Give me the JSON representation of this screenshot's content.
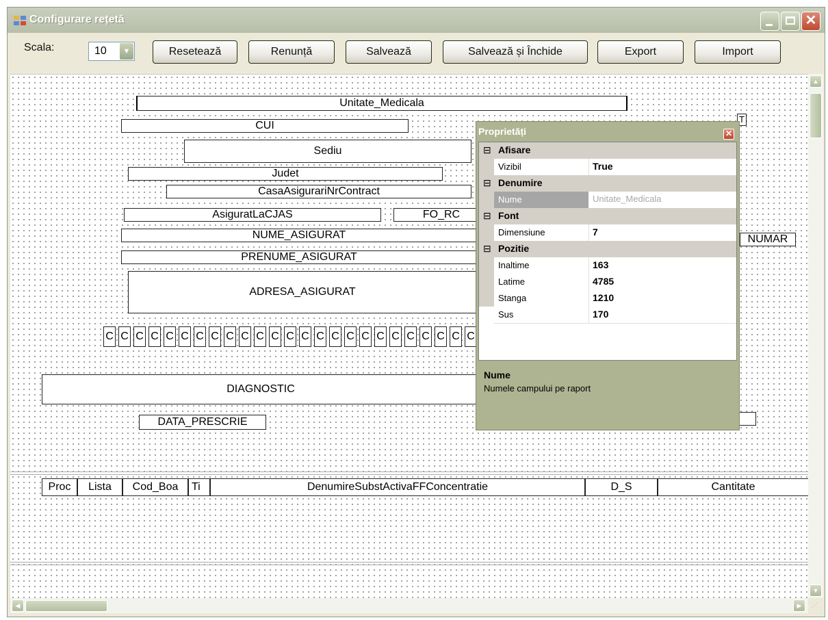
{
  "window": {
    "title": "Configurare rețetă"
  },
  "toolbar": {
    "scale_label": "Scala:",
    "scale_value": "10",
    "buttons": [
      "Resetează",
      "Renunță",
      "Salvează",
      "Salvează și Închide",
      "Export",
      "Import"
    ]
  },
  "canvas": {
    "fields": [
      "Unitate_Medicala",
      "CUI",
      "Sediu",
      "Judet",
      "CasaAsigurariNrContract",
      "AsiguratLaCJAS",
      "FO_RC",
      "NUME_ASIGURAT",
      "NUMAR",
      "PRENUME_ASIGURAT",
      "ADRESA_ASIGURAT",
      "DIAGNOSTIC",
      "DATA_PRESCRIE",
      "T"
    ],
    "char_box_label": "C",
    "table_headers": [
      "Proc",
      "Lista",
      "Cod_Boa",
      "Ti",
      "DenumireSubstActivaFFConcentratie",
      "D_S",
      "Cantitate"
    ]
  },
  "properties_panel": {
    "title": "Proprietăți",
    "categories": [
      {
        "name": "Afisare",
        "rows": [
          {
            "name": "Vizibil",
            "value": "True"
          }
        ]
      },
      {
        "name": "Denumire",
        "rows": [
          {
            "name": "Nume",
            "value": "Unitate_Medicala"
          }
        ]
      },
      {
        "name": "Font",
        "rows": [
          {
            "name": "Dimensiune",
            "value": "7"
          }
        ]
      },
      {
        "name": "Pozitie",
        "rows": [
          {
            "name": "Inaltime",
            "value": "163"
          },
          {
            "name": "Latime",
            "value": "4785"
          },
          {
            "name": "Stanga",
            "value": "1210"
          },
          {
            "name": "Sus",
            "value": "170"
          }
        ]
      }
    ],
    "help_title": "Nume",
    "help_text": "Numele campului pe raport"
  }
}
